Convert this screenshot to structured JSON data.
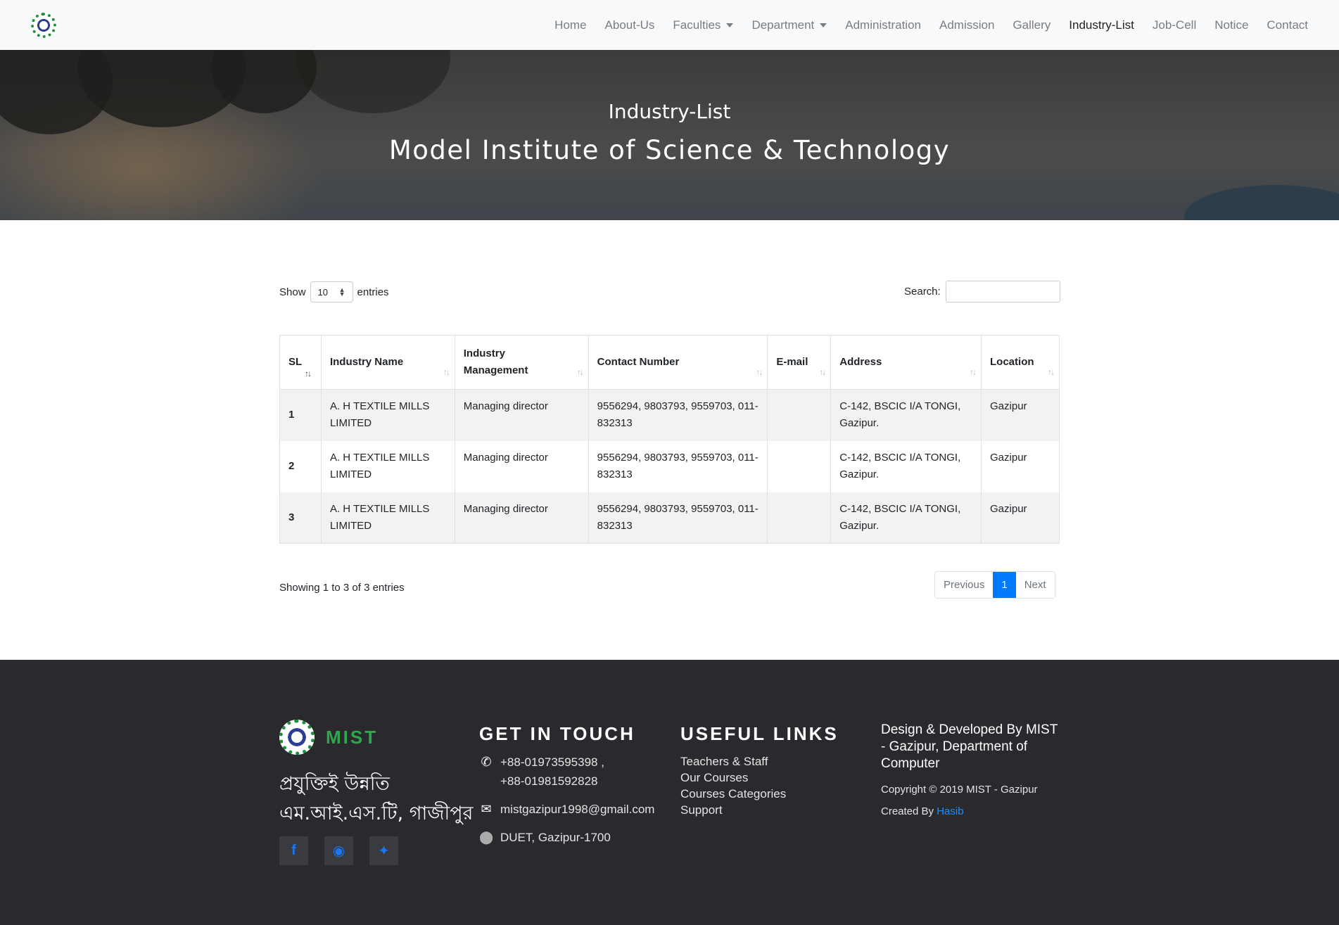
{
  "nav": {
    "items": [
      {
        "label": "Home",
        "dropdown": false,
        "active": false
      },
      {
        "label": "About-Us",
        "dropdown": false,
        "active": false
      },
      {
        "label": "Faculties",
        "dropdown": true,
        "active": false
      },
      {
        "label": "Department",
        "dropdown": true,
        "active": false
      },
      {
        "label": "Administration",
        "dropdown": false,
        "active": false
      },
      {
        "label": "Admission",
        "dropdown": false,
        "active": false
      },
      {
        "label": "Gallery",
        "dropdown": false,
        "active": false
      },
      {
        "label": "Industry-List",
        "dropdown": false,
        "active": true
      },
      {
        "label": "Job-Cell",
        "dropdown": false,
        "active": false
      },
      {
        "label": "Notice",
        "dropdown": false,
        "active": false
      },
      {
        "label": "Contact",
        "dropdown": false,
        "active": false
      }
    ]
  },
  "hero": {
    "subtitle": "Industry-List",
    "title": "Model Institute of Science & Technology"
  },
  "controls": {
    "show_label": "Show",
    "entries_value": "10",
    "entries_label": "entries",
    "search_label": "Search:"
  },
  "table": {
    "headers": [
      "SL",
      "Industry Name",
      "Industry Management",
      "Contact Number",
      "E-mail",
      "Address",
      "Location"
    ],
    "rows": [
      {
        "sl": "1",
        "name": "A. H TEXTILE MILLS LIMITED",
        "management": "Managing director",
        "contact": "9556294, 9803793, 9559703, 011-832313",
        "email": "",
        "address": "C-142, BSCIC I/A TONGI, Gazipur.",
        "location": "Gazipur"
      },
      {
        "sl": "2",
        "name": "A. H TEXTILE MILLS LIMITED",
        "management": "Managing director",
        "contact": "9556294, 9803793, 9559703, 011-832313",
        "email": "",
        "address": "C-142, BSCIC I/A TONGI, Gazipur.",
        "location": "Gazipur"
      },
      {
        "sl": "3",
        "name": "A. H TEXTILE MILLS LIMITED",
        "management": "Managing director",
        "contact": "9556294, 9803793, 9559703, 011-832313",
        "email": "",
        "address": "C-142, BSCIC I/A TONGI, Gazipur.",
        "location": "Gazipur"
      }
    ],
    "info": "Showing 1 to 3 of 3 entries"
  },
  "pagination": {
    "previous": "Previous",
    "current": "1",
    "next": "Next",
    "active_color": "#007bff"
  },
  "footer": {
    "brand": "MIST",
    "tagline_line1": "প্রযুক্তিই উন্নতি",
    "tagline_line2": "এম.আই.এস.টি, গাজীপুর",
    "socials": [
      {
        "icon": "facebook-icon",
        "glyph": "f"
      },
      {
        "icon": "messenger-icon",
        "glyph": "◉"
      },
      {
        "icon": "twitter-icon",
        "glyph": "✦"
      }
    ],
    "touch_heading": "GET IN TOUCH",
    "phone": "+88-01973595398 ,",
    "phone2": "+88-01981592828",
    "email": "mistgazipur1998@gmail.com",
    "address": "DUET, Gazipur-1700",
    "links_heading": "USEFUL LINKS",
    "links": [
      "Teachers & Staff",
      "Our Courses",
      "Courses Categories",
      "Support"
    ],
    "dev_credit": "Design & Developed By MIST - Gazipur, Department of Computer",
    "copyright": "Copyright © 2019 MIST - Gazipur",
    "created_by_label": "Created By",
    "created_by_name": "Hasib",
    "brand_color": "#2ea84b",
    "link_color": "#1e90ff"
  }
}
